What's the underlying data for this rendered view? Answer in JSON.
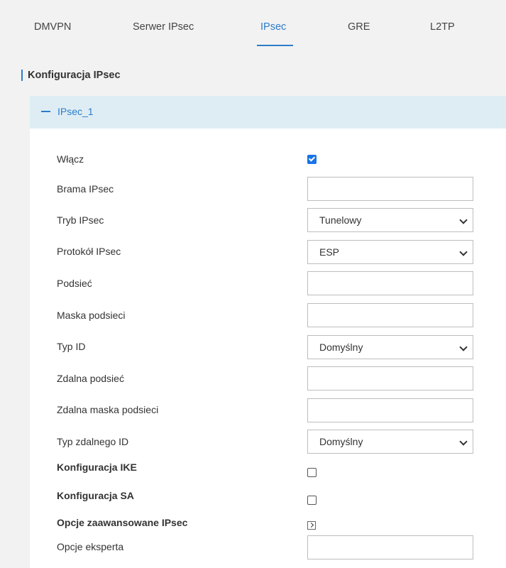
{
  "tabs": [
    {
      "label": "DMVPN",
      "active": false
    },
    {
      "label": "Serwer IPsec",
      "active": false
    },
    {
      "label": "IPsec",
      "active": true
    },
    {
      "label": "GRE",
      "active": false
    },
    {
      "label": "L2TP",
      "active": false
    }
  ],
  "section_title": "Konfiguracja IPsec",
  "panel": {
    "title": "IPsec_1",
    "fields": {
      "enable": {
        "label": "Włącz",
        "checked": true
      },
      "gateway": {
        "label": "Brama IPsec",
        "value": ""
      },
      "mode": {
        "label": "Tryb IPsec",
        "value": "Tunelowy"
      },
      "protocol": {
        "label": "Protokół IPsec",
        "value": "ESP"
      },
      "subnet": {
        "label": "Podsieć",
        "value": ""
      },
      "subnet_mask": {
        "label": "Maska podsieci",
        "value": ""
      },
      "id_type": {
        "label": "Typ ID",
        "value": "Domyślny"
      },
      "remote_subnet": {
        "label": "Zdalna podsieć",
        "value": ""
      },
      "remote_mask": {
        "label": "Zdalna maska podsieci",
        "value": ""
      },
      "remote_id_type": {
        "label": "Typ zdalnego ID",
        "value": "Domyślny"
      },
      "ike_config": {
        "label": "Konfiguracja IKE",
        "checked": false
      },
      "sa_config": {
        "label": "Konfiguracja SA",
        "checked": false
      },
      "advanced": {
        "label": "Opcje zaawansowane IPsec"
      },
      "expert": {
        "label": "Opcje eksperta",
        "value": ""
      }
    }
  },
  "colors": {
    "accent": "#2c7cc9",
    "panel_header_bg": "#deedf4",
    "checkbox_checked": "#1a73e8"
  }
}
